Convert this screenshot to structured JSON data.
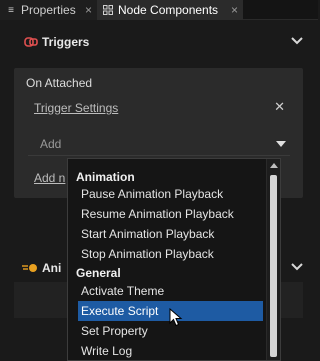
{
  "tabs": [
    {
      "label": "Properties",
      "icon": "list-icon"
    },
    {
      "label": "Node Components",
      "icon": "components-icon"
    }
  ],
  "triggers_section": {
    "title": "Triggers",
    "trigger": {
      "name": "On Attached",
      "settings_link": "Trigger Settings",
      "add_placeholder": "Add",
      "add_new_link": "Add n"
    }
  },
  "second_section": {
    "title": "Ani"
  },
  "dropdown": {
    "groups": [
      {
        "label": "Animation",
        "items": [
          "Pause Animation Playback",
          "Resume Animation Playback",
          "Start Animation Playback",
          "Stop Animation Playback"
        ]
      },
      {
        "label": "General",
        "items": [
          "Activate Theme",
          "Execute Script",
          "Set Property",
          "Write Log"
        ]
      }
    ],
    "selected": "Execute Script"
  },
  "colors": {
    "background": "#1a1a1a",
    "panel": "#2b2b2b",
    "selection": "#1e5ba3",
    "trigger_icon": "#e05050",
    "animation_icon": "#e8a020"
  }
}
